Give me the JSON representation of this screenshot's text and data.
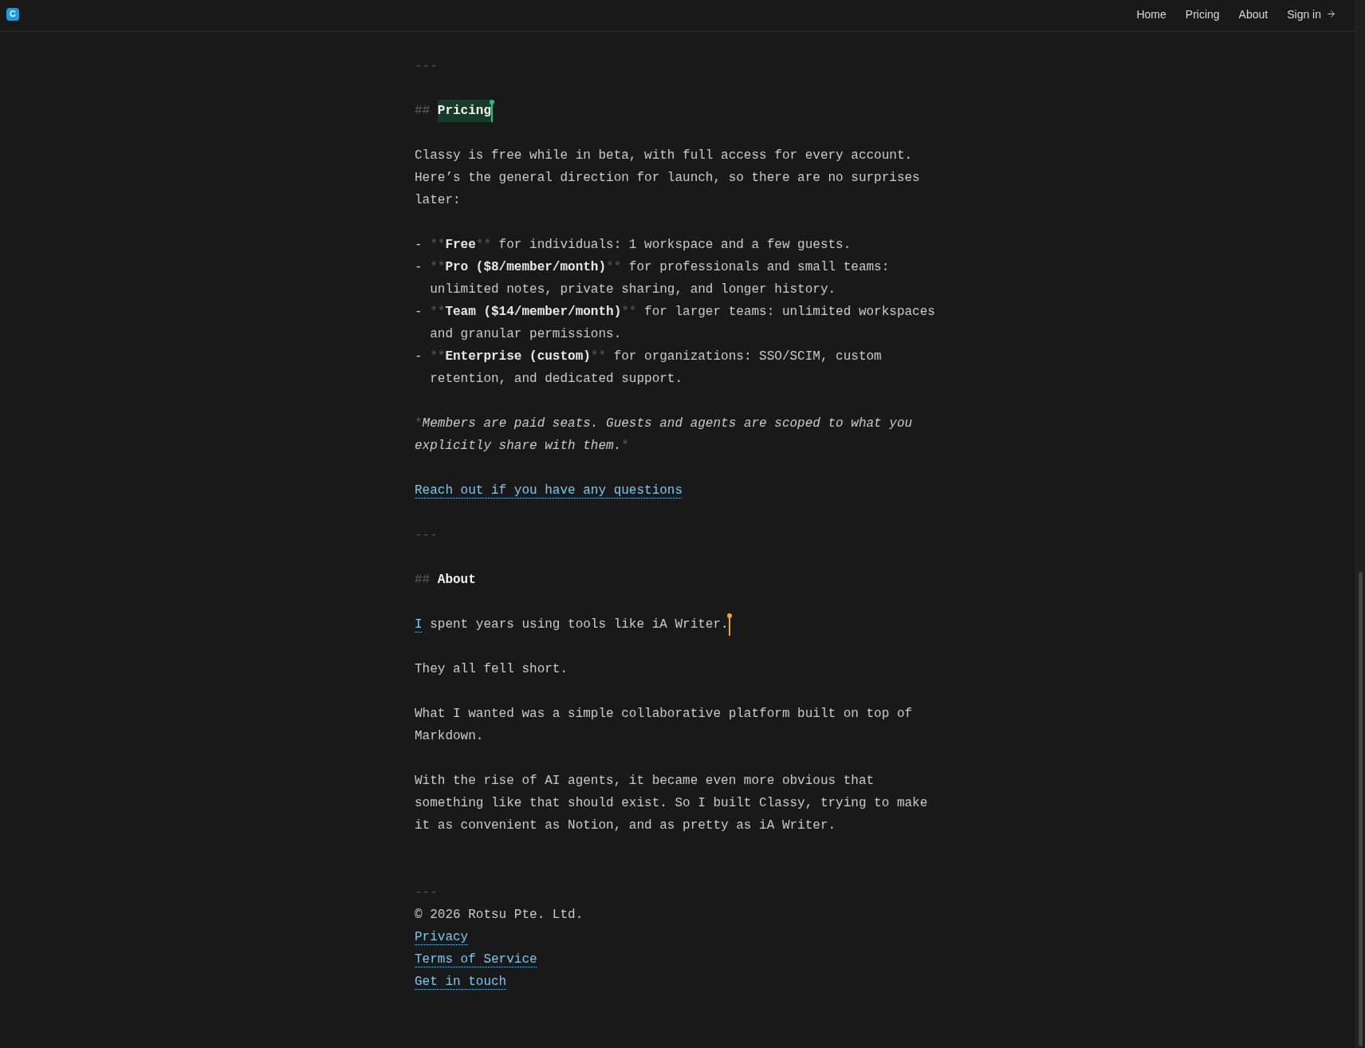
{
  "nav": {
    "logo": "C",
    "links": [
      {
        "kind": "page",
        "label": "Home"
      },
      {
        "kind": "page",
        "label": "Pricing"
      },
      {
        "kind": "page",
        "label": "About"
      },
      {
        "kind": "signin",
        "label": "Sign in"
      }
    ]
  },
  "document": [
    {
      "kind": "rule",
      "text": "---"
    },
    {
      "kind": "heading",
      "marker": "##",
      "text": "Pricing",
      "highlighted": true,
      "cursor": {
        "color": "#22c389"
      }
    },
    {
      "kind": "paragraph",
      "segments": [
        {
          "kind": "plain",
          "text": "Classy is free while in beta, with full access for every account. Here’s the general direction for launch, so there are no surprises later:"
        }
      ]
    },
    {
      "kind": "list",
      "items": [
        {
          "bullet": "-",
          "segments": [
            {
              "kind": "marker",
              "text": "**"
            },
            {
              "kind": "bold",
              "text": "Free"
            },
            {
              "kind": "marker",
              "text": "**"
            },
            {
              "kind": "plain",
              "text": " for individuals: 1 workspace and a few guests."
            }
          ]
        },
        {
          "bullet": "-",
          "segments": [
            {
              "kind": "marker",
              "text": "**"
            },
            {
              "kind": "bold",
              "text": "Pro ($8/member/month)"
            },
            {
              "kind": "marker",
              "text": "**"
            },
            {
              "kind": "plain",
              "text": " for professionals and small teams: unlimited notes, private sharing, and longer history."
            }
          ]
        },
        {
          "bullet": "-",
          "segments": [
            {
              "kind": "marker",
              "text": "**"
            },
            {
              "kind": "bold",
              "text": "Team ($14/member/month)"
            },
            {
              "kind": "marker",
              "text": "**"
            },
            {
              "kind": "plain",
              "text": " for larger teams: unlimited workspaces and granular permissions."
            }
          ]
        },
        {
          "bullet": "-",
          "segments": [
            {
              "kind": "marker",
              "text": "**"
            },
            {
              "kind": "bold",
              "text": "Enterprise (custom)"
            },
            {
              "kind": "marker",
              "text": "**"
            },
            {
              "kind": "plain",
              "text": " for organizations: SSO/SCIM, custom retention, and dedicated support."
            }
          ]
        }
      ]
    },
    {
      "kind": "paragraph",
      "segments": [
        {
          "kind": "marker",
          "text": "*"
        },
        {
          "kind": "italic",
          "text": "Members are paid seats. Guests and agents are scoped to what you explicitly share with them."
        },
        {
          "kind": "marker",
          "text": "*"
        }
      ]
    },
    {
      "kind": "link",
      "text": "Reach out if you have any questions"
    },
    {
      "kind": "rule",
      "text": "---"
    },
    {
      "kind": "heading",
      "marker": "##",
      "text": "About",
      "highlighted": false
    },
    {
      "kind": "paragraph",
      "segments": [
        {
          "kind": "link",
          "text": "I"
        },
        {
          "kind": "plain",
          "text": " spent years using tools like iA Writer."
        }
      ],
      "cursor": {
        "color": "#f5a524"
      }
    },
    {
      "kind": "paragraph",
      "segments": [
        {
          "kind": "plain",
          "text": "They all fell short."
        }
      ]
    },
    {
      "kind": "paragraph",
      "segments": [
        {
          "kind": "plain",
          "text": "What I wanted was a simple collaborative platform built on top of Markdown."
        }
      ]
    },
    {
      "kind": "paragraph",
      "segments": [
        {
          "kind": "plain",
          "text": "With the rise of AI agents, it became even more obvious that something like that should exist. So I built Classy, trying to make it as convenient as Notion, and as pretty as iA Writer."
        }
      ]
    }
  ],
  "footer": {
    "rule": "---",
    "copyright": "© 2026 Rotsu Pte. Ltd.",
    "links": [
      "Privacy",
      "Terms of Service",
      "Get in touch"
    ]
  }
}
